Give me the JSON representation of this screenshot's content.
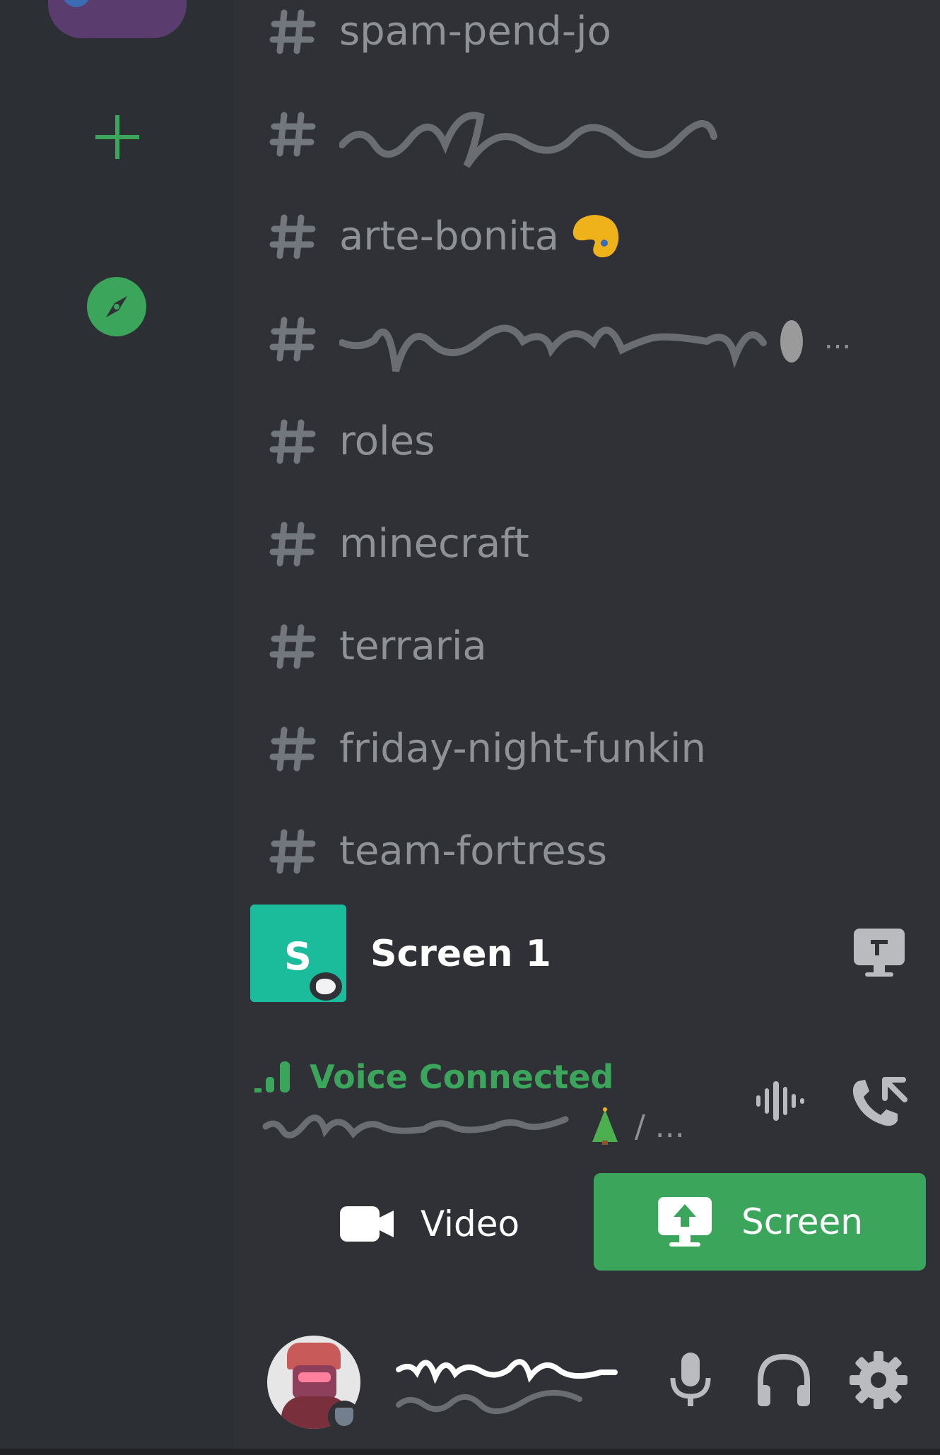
{
  "colors": {
    "rail_background": "#2c2f33",
    "sidebar_background": "#2f3136",
    "channel_text": "#8e9297",
    "accent_green": "#3ba55c",
    "screen_thumb": "#1abc9c",
    "white": "#ffffff"
  },
  "guild_rail": {
    "add_server_icon": "plus-icon",
    "explore_icon": "compass-icon"
  },
  "channels": [
    {
      "name": "spam-pend-jo",
      "icon": "text-channel-hash-icon"
    },
    {
      "name": "",
      "icon": "text-channel-hash-icon",
      "redacted": true
    },
    {
      "name": "arte-bonita",
      "icon": "text-channel-hash-icon",
      "emoji": "palette"
    },
    {
      "name": "",
      "icon": "text-channel-hash-icon",
      "redacted": true,
      "suffix": "..."
    },
    {
      "name": "roles",
      "icon": "text-channel-hash-icon"
    },
    {
      "name": "minecraft",
      "icon": "text-channel-hash-icon"
    },
    {
      "name": "terraria",
      "icon": "text-channel-hash-icon"
    },
    {
      "name": "friday-night-funkin",
      "icon": "text-channel-hash-icon"
    },
    {
      "name": "team-fortress",
      "icon": "text-channel-hash-icon"
    }
  ],
  "screen_share": {
    "label": "Screen 1",
    "thumb_letter": "S",
    "icon": "screen-share-icon"
  },
  "voice": {
    "status": "Voice Connected",
    "channel_separator": "/ ...",
    "noise_icon": "noise-suppression-icon",
    "disconnect_icon": "disconnect-icon"
  },
  "actions": {
    "video_label": "Video",
    "screen_label": "Screen"
  },
  "user_panel": {
    "mic_icon": "microphone-icon",
    "headset_icon": "headset-icon",
    "settings_icon": "gear-icon"
  }
}
